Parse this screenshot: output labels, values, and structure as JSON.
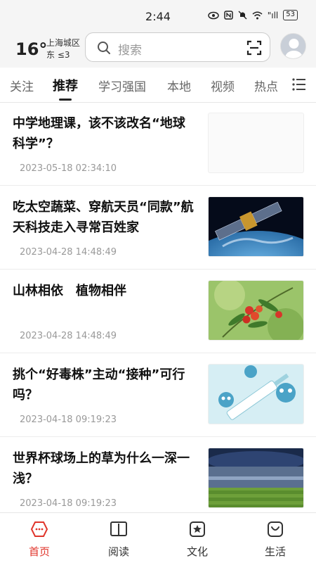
{
  "status_bar": {
    "time": "2:44",
    "network": "\"ıll",
    "battery": "53"
  },
  "weather": {
    "temperature": "16°",
    "city": "上海城区",
    "wind": "东  ≤3"
  },
  "search": {
    "placeholder": "搜索"
  },
  "tabs": [
    {
      "label": "关注"
    },
    {
      "label": "推荐"
    },
    {
      "label": "学习强国"
    },
    {
      "label": "本地"
    },
    {
      "label": "视频"
    },
    {
      "label": "热点"
    }
  ],
  "active_tab": "推荐",
  "news": [
    {
      "title": "中学地理课，该不该改名“地球科学”？",
      "date": "2023-05-18 02:34:10",
      "thumb": "none"
    },
    {
      "title": "吃太空蔬菜、穿航天员“同款”航天科技走入寻常百姓家",
      "date": "2023-04-28 14:48:49",
      "thumb": "satellite-earth"
    },
    {
      "title": "山林相依　植物相伴",
      "date": "2023-04-28 14:48:49",
      "thumb": "red-berries"
    },
    {
      "title": "挑个“好毒株”主动“接种”可行吗？",
      "date": "2023-04-18 09:19:23",
      "thumb": "virus-syringe-cartoon"
    },
    {
      "title": "世界杯球场上的草为什么一深一浅？",
      "date": "2023-04-18 09:19:23",
      "thumb": "football-stadium"
    }
  ],
  "bottom_nav": [
    {
      "label": "首页",
      "icon": "home-icon",
      "active": true
    },
    {
      "label": "阅读",
      "icon": "book-icon",
      "active": false
    },
    {
      "label": "文化",
      "icon": "star-card-icon",
      "active": false
    },
    {
      "label": "生活",
      "icon": "smile-bag-icon",
      "active": false
    }
  ],
  "colors": {
    "accent": "#e0352b",
    "text": "#111111",
    "muted": "#999999"
  }
}
